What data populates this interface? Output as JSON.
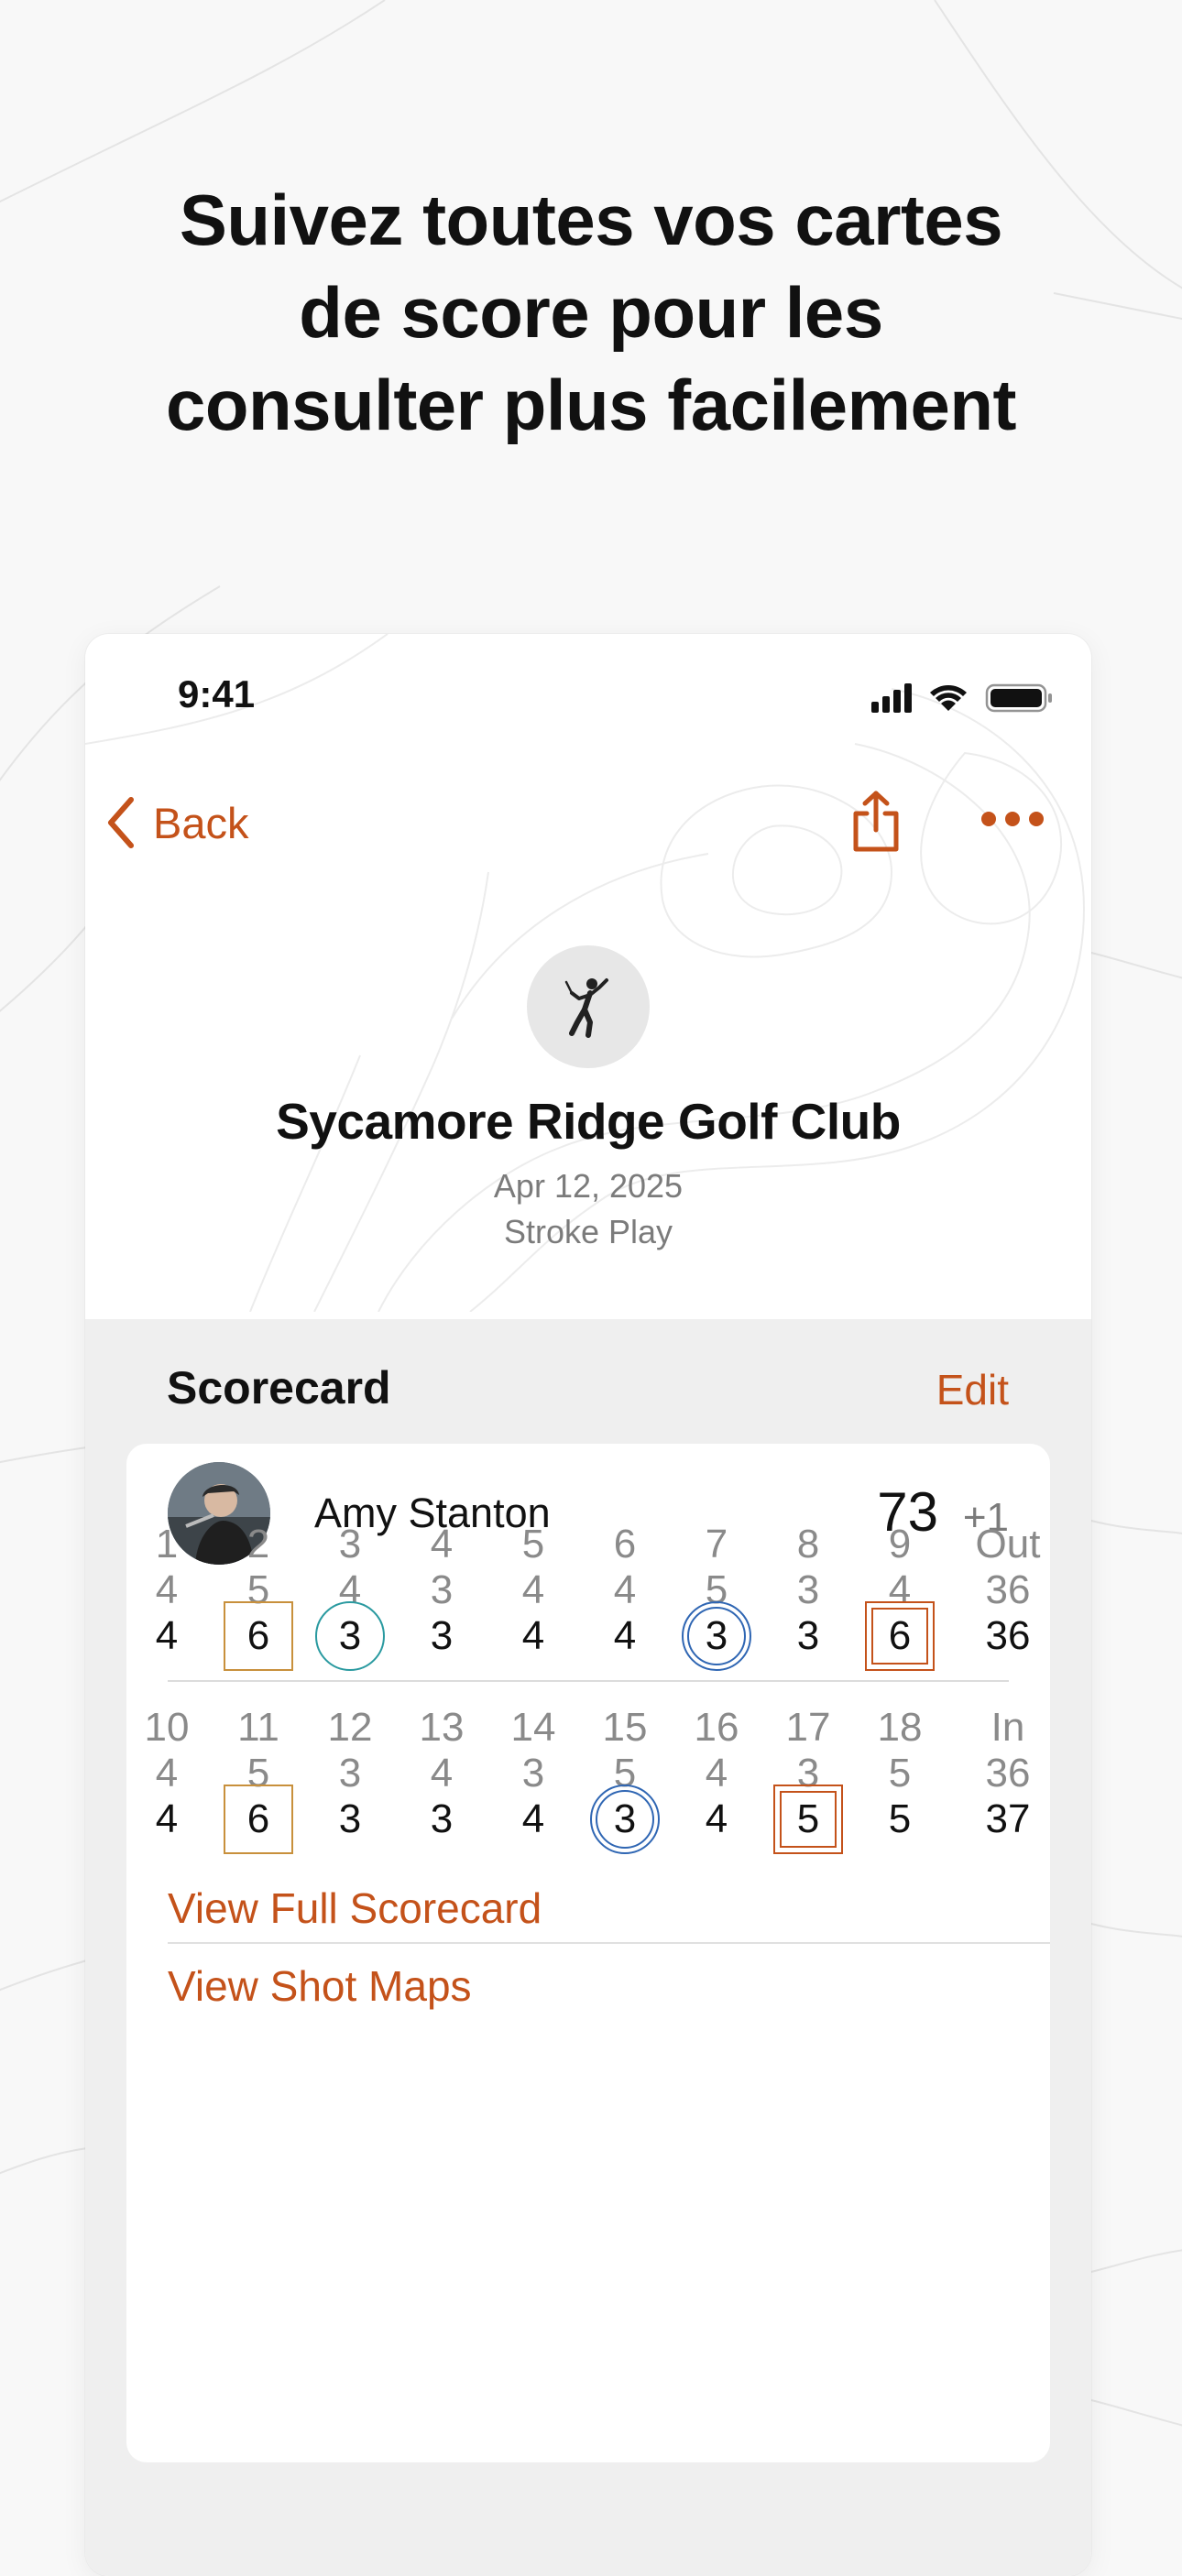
{
  "headline": {
    "lines": [
      "Suivez toutes vos cartes",
      "de score pour les",
      "consulter plus facilement"
    ]
  },
  "status_bar": {
    "time": "9:41"
  },
  "nav": {
    "back_label": "Back"
  },
  "round": {
    "course_name": "Sycamore Ridge Golf Club",
    "date": "Apr 12, 2025",
    "format": "Stroke Play"
  },
  "scorecard": {
    "title": "Scorecard",
    "edit_label": "Edit",
    "player": {
      "name": "Amy Stanton",
      "total": "73",
      "to_par": "+1"
    },
    "front": {
      "holes": [
        "1",
        "2",
        "3",
        "4",
        "5",
        "6",
        "7",
        "8",
        "9",
        "Out"
      ],
      "pars": [
        "4",
        "5",
        "4",
        "3",
        "4",
        "4",
        "5",
        "3",
        "4",
        "36"
      ],
      "scores": [
        "4",
        "6",
        "3",
        "3",
        "4",
        "4",
        "3",
        "3",
        "6",
        "36"
      ],
      "markers": [
        "",
        "bogey",
        "birdie",
        "",
        "",
        "",
        "eagle",
        "",
        "double",
        ""
      ]
    },
    "back": {
      "holes": [
        "10",
        "11",
        "12",
        "13",
        "14",
        "15",
        "16",
        "17",
        "18",
        "In"
      ],
      "pars": [
        "4",
        "5",
        "3",
        "4",
        "3",
        "5",
        "4",
        "3",
        "5",
        "36"
      ],
      "scores": [
        "4",
        "6",
        "3",
        "3",
        "4",
        "3",
        "4",
        "5",
        "5",
        "37"
      ],
      "markers": [
        "",
        "bogey",
        "",
        "",
        "",
        "eagle",
        "",
        "double",
        "",
        ""
      ]
    },
    "view_full_label": "View Full Scorecard",
    "view_shot_maps_label": "View Shot Maps"
  },
  "colors": {
    "accent": "#c4521a",
    "bogey": "#c8903c",
    "birdie": "#2a9aa0",
    "eagle": "#2f66b3",
    "double_bogey": "#c4521a"
  }
}
